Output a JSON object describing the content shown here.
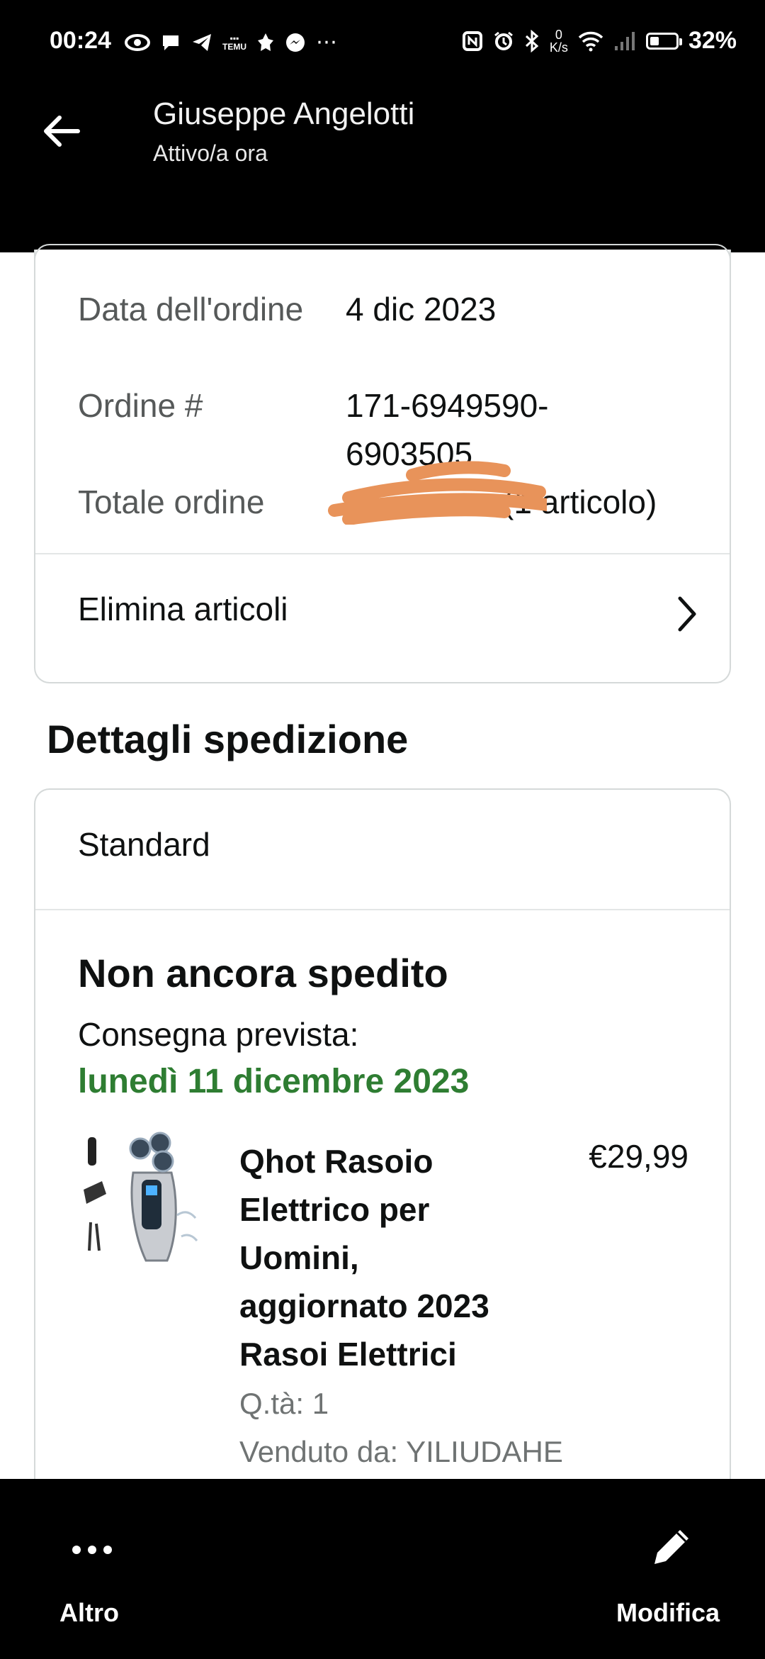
{
  "status_bar": {
    "time": "00:24",
    "net_speed_value": "0",
    "net_speed_unit": "K/s",
    "battery_percent": "32%"
  },
  "header": {
    "contact_name": "Giuseppe Angelotti",
    "contact_status": "Attivo/a ora"
  },
  "order": {
    "date_label": "Data dell'ordine",
    "date_value": "4 dic 2023",
    "number_label": "Ordine #",
    "number_value_line1": "171-6949590-",
    "number_value_line2": "6903505",
    "total_label": "Totale ordine",
    "total_value_visible": "(1 articolo)",
    "remove_items_label": "Elimina articoli"
  },
  "shipping": {
    "section_title": "Dettagli spedizione",
    "method": "Standard",
    "status": "Non ancora spedito",
    "delivery_label": "Consegna prevista:",
    "delivery_date": "lunedì 11 dicembre 2023",
    "colors": {
      "delivery_date": "#2e7d32"
    }
  },
  "product": {
    "title_line1": "Qhot Rasoio",
    "title_line2": "Elettrico per",
    "title_line3": "Uomini,",
    "title_line4": "aggiornato 2023",
    "title_line5": "Rasoi Elettrici",
    "price": "€29,99",
    "quantity": "Q.tà: 1",
    "seller": "Venduto da: YILIUDAHE"
  },
  "bottom_bar": {
    "more_label": "Altro",
    "edit_label": "Modifica"
  }
}
